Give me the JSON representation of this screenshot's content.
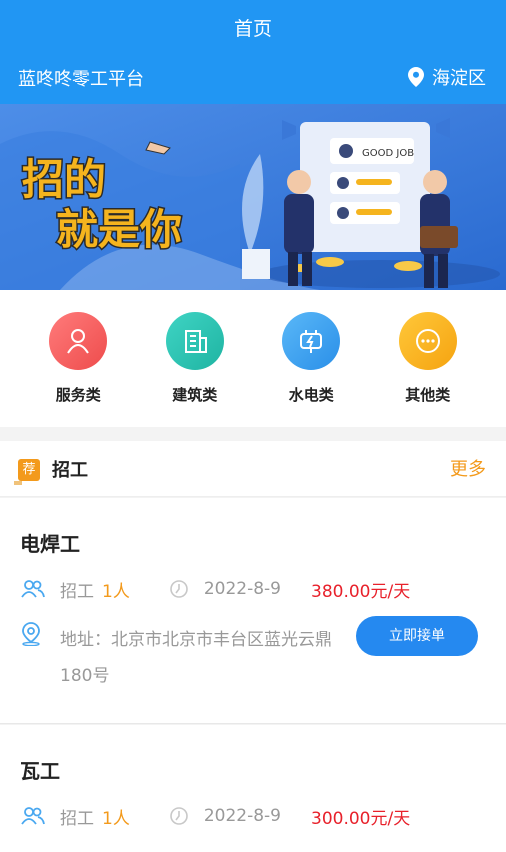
{
  "header": {
    "title": "首页",
    "platform": "蓝咚咚零工平台",
    "location": "海淀区"
  },
  "banner": {
    "slogan_lines": [
      "招的",
      "就是你"
    ],
    "badge": "GOOD JOB"
  },
  "categories": [
    {
      "label": "服务类",
      "icon": "person-icon",
      "color": "#f05a5a"
    },
    {
      "label": "建筑类",
      "icon": "building-icon",
      "color": "#25c0b0"
    },
    {
      "label": "水电类",
      "icon": "plug-icon",
      "color": "#2ea2f0"
    },
    {
      "label": "其他类",
      "icon": "more-icon",
      "color": "#f5b41e"
    }
  ],
  "section": {
    "tag": "荐",
    "title": "招工",
    "more": "更多"
  },
  "jobs": [
    {
      "name": "电焊工",
      "recruit_label": "招工",
      "count": "1人",
      "date": "2022-8-9",
      "price": "380.00元/天",
      "address": "地址：北京市北京市丰台区蓝光云鼎180号",
      "button": "立即接单"
    },
    {
      "name": "瓦工",
      "recruit_label": "招工",
      "count": "1人",
      "date": "2022-8-9",
      "price": "300.00元/天"
    }
  ]
}
